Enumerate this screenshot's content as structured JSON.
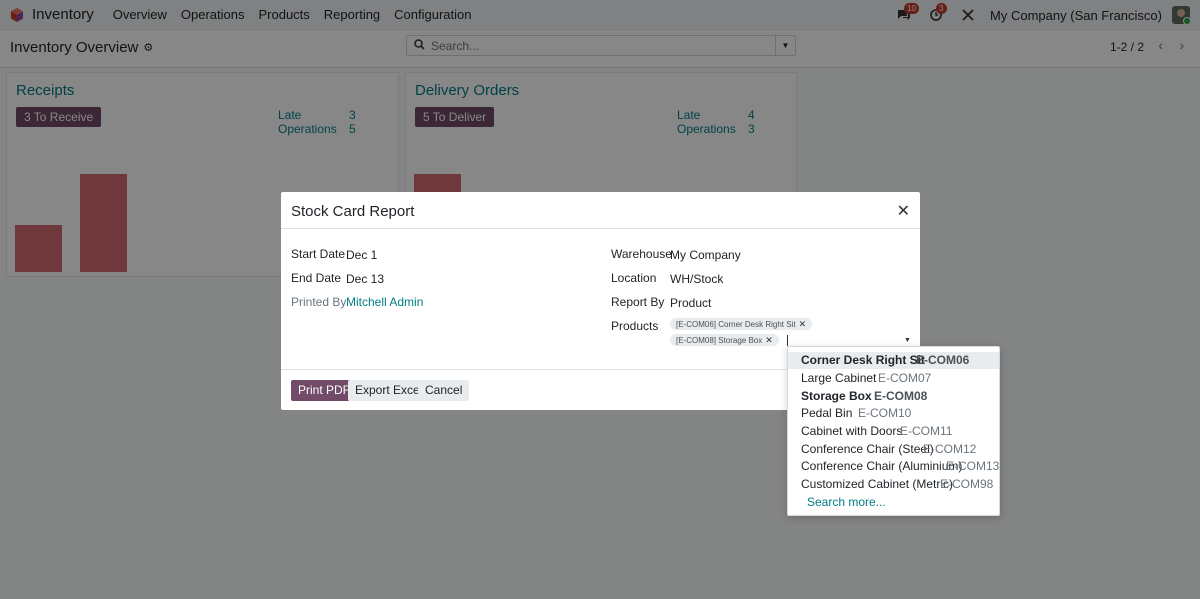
{
  "navbar": {
    "app_name": "Inventory",
    "menu": [
      "Overview",
      "Operations",
      "Products",
      "Reporting",
      "Configuration"
    ],
    "chat_badge": "10",
    "activity_badge": "3",
    "company": "My Company (San Francisco)"
  },
  "control": {
    "breadcrumb": "Inventory Overview",
    "search_placeholder": "Search...",
    "pager": "1-2 / 2"
  },
  "cards": [
    {
      "title": "Receipts",
      "button": "3 To Receive",
      "late_label": "Late",
      "late_value": "3",
      "ops_label": "Operations",
      "ops_value": "5",
      "bars": [
        0.48,
        1.0
      ]
    },
    {
      "title": "Delivery Orders",
      "button": "5 To Deliver",
      "late_label": "Late",
      "late_value": "4",
      "ops_label": "Operations",
      "ops_value": "3",
      "bars": [
        1.0
      ]
    }
  ],
  "modal": {
    "title": "Stock Card Report",
    "start_date_label": "Start Date",
    "start_date": "Dec 1",
    "end_date_label": "End Date",
    "end_date": "Dec 13",
    "printed_by_label": "Printed By",
    "printed_by": "Mitchell Admin",
    "warehouse_label": "Warehouse",
    "warehouse": "My Company",
    "location_label": "Location",
    "location": "WH/Stock",
    "report_by_label": "Report By",
    "report_by": "Product",
    "products_label": "Products",
    "tags": [
      "[E-COM06] Corner Desk Right Sit",
      "[E-COM08] Storage Box"
    ],
    "buttons": {
      "print_pdf": "Print PDF",
      "export_excel": "Export Excel",
      "cancel": "Cancel"
    }
  },
  "dropdown": {
    "options": [
      {
        "name": "Corner Desk Right Sit",
        "code": "E-COM06",
        "selected": true
      },
      {
        "name": "Large Cabinet",
        "code": "E-COM07",
        "selected": false
      },
      {
        "name": "Storage Box",
        "code": "E-COM08",
        "selected": true
      },
      {
        "name": "Pedal Bin",
        "code": "E-COM10",
        "selected": false
      },
      {
        "name": "Cabinet with Doors",
        "code": "E-COM11",
        "selected": false
      },
      {
        "name": "Conference Chair (Steel)",
        "code": "E-COM12",
        "selected": false
      },
      {
        "name": "Conference Chair (Aluminium)",
        "code": "E-COM13",
        "selected": false
      },
      {
        "name": "Customized Cabinet (Metric)",
        "code": "E-COM98",
        "selected": false
      }
    ],
    "search_more": "Search more..."
  },
  "colors": {
    "primary": "#714b67",
    "link": "#017e84",
    "bar": "#c9515c"
  }
}
